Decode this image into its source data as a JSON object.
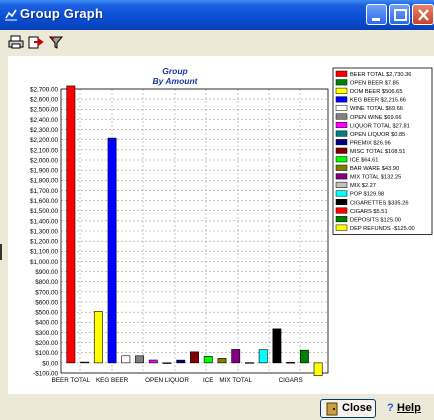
{
  "window": {
    "title": "Group Graph"
  },
  "toolbar": {
    "items": [
      "print-icon",
      "export-icon",
      "filter-icon"
    ]
  },
  "chart_data": {
    "type": "bar",
    "title": "Group",
    "subtitle": "By Amount",
    "ylim": [
      -100,
      2700
    ],
    "yticks": [
      "$2,700.00",
      "$2,600.00",
      "$2,500.00",
      "$2,400.00",
      "$2,300.00",
      "$2,200.00",
      "$2,100.00",
      "$2,000.00",
      "$1,900.00",
      "$1,800.00",
      "$1,700.00",
      "$1,600.00",
      "$1,500.00",
      "$1,400.00",
      "$1,300.00",
      "$1,200.00",
      "$1,100.00",
      "$1,000.00",
      "$900.00",
      "$800.00",
      "$700.00",
      "$600.00",
      "$500.00",
      "$400.00",
      "$300.00",
      "$200.00",
      "$100.00",
      "$0.00",
      "-$100.00"
    ],
    "xticklabels": [
      "BEER TOTAL",
      "KEG BEER",
      "OPEN LIQUOR",
      "ICE",
      "MIX TOTAL",
      "CIGARS"
    ],
    "grid": true,
    "legend": "right",
    "categories": [
      "BEER TOTAL",
      "OPEN BEER",
      "DOM BEER",
      "KEG BEER",
      "WINE TOTAL",
      "OPEN WINE",
      "LIQUOR TOTAL",
      "OPEN LIQUOR",
      "PREMIX",
      "MISC TOTAL",
      "ICE",
      "BAR WARE",
      "MIX TOTAL",
      "MIX",
      "POP",
      "CIGARETTES",
      "CIGARS",
      "DEPOSITS",
      "DEP REFUNDS"
    ],
    "values": [
      2730.36,
      7.85,
      506.65,
      2215.66,
      69.66,
      69.66,
      27.81,
      0.85,
      26.96,
      108.51,
      64.61,
      43.9,
      132.25,
      2.27,
      129.98,
      335.26,
      5.51,
      125.0,
      -125.0
    ],
    "colors": [
      "#ff0000",
      "#008000",
      "#ffff00",
      "#0000ff",
      "#ffffff",
      "#808080",
      "#ff00ff",
      "#008080",
      "#000080",
      "#800000",
      "#00ff00",
      "#808000",
      "#800080",
      "#c0c0c0",
      "#00ffff",
      "#000000",
      "#ff0000",
      "#008000",
      "#ffff00"
    ],
    "legend_entries": [
      "BEER TOTAL $2,730.36",
      "OPEN BEER $7.85",
      "DOM BEER $506.65",
      "KEG BEER $2,215.66",
      "WINE TOTAL $69.66",
      "OPEN WINE $69.66",
      "LIQUOR TOTAL $27.81",
      "OPEN LIQUOR $0.85",
      "PREMIX $26.96",
      "MISC TOTAL $108.51",
      "ICE $64.61",
      "BAR WARE $43.90",
      "MIX TOTAL $132.25",
      "MIX $2.27",
      "POP $129.98",
      "CIGARETTES $335.26",
      "CIGARS $5.51",
      "DEPOSITS $125.00",
      "DEP REFUNDS -$125.00"
    ]
  },
  "buttons": {
    "close": "Close",
    "help": "Help"
  }
}
